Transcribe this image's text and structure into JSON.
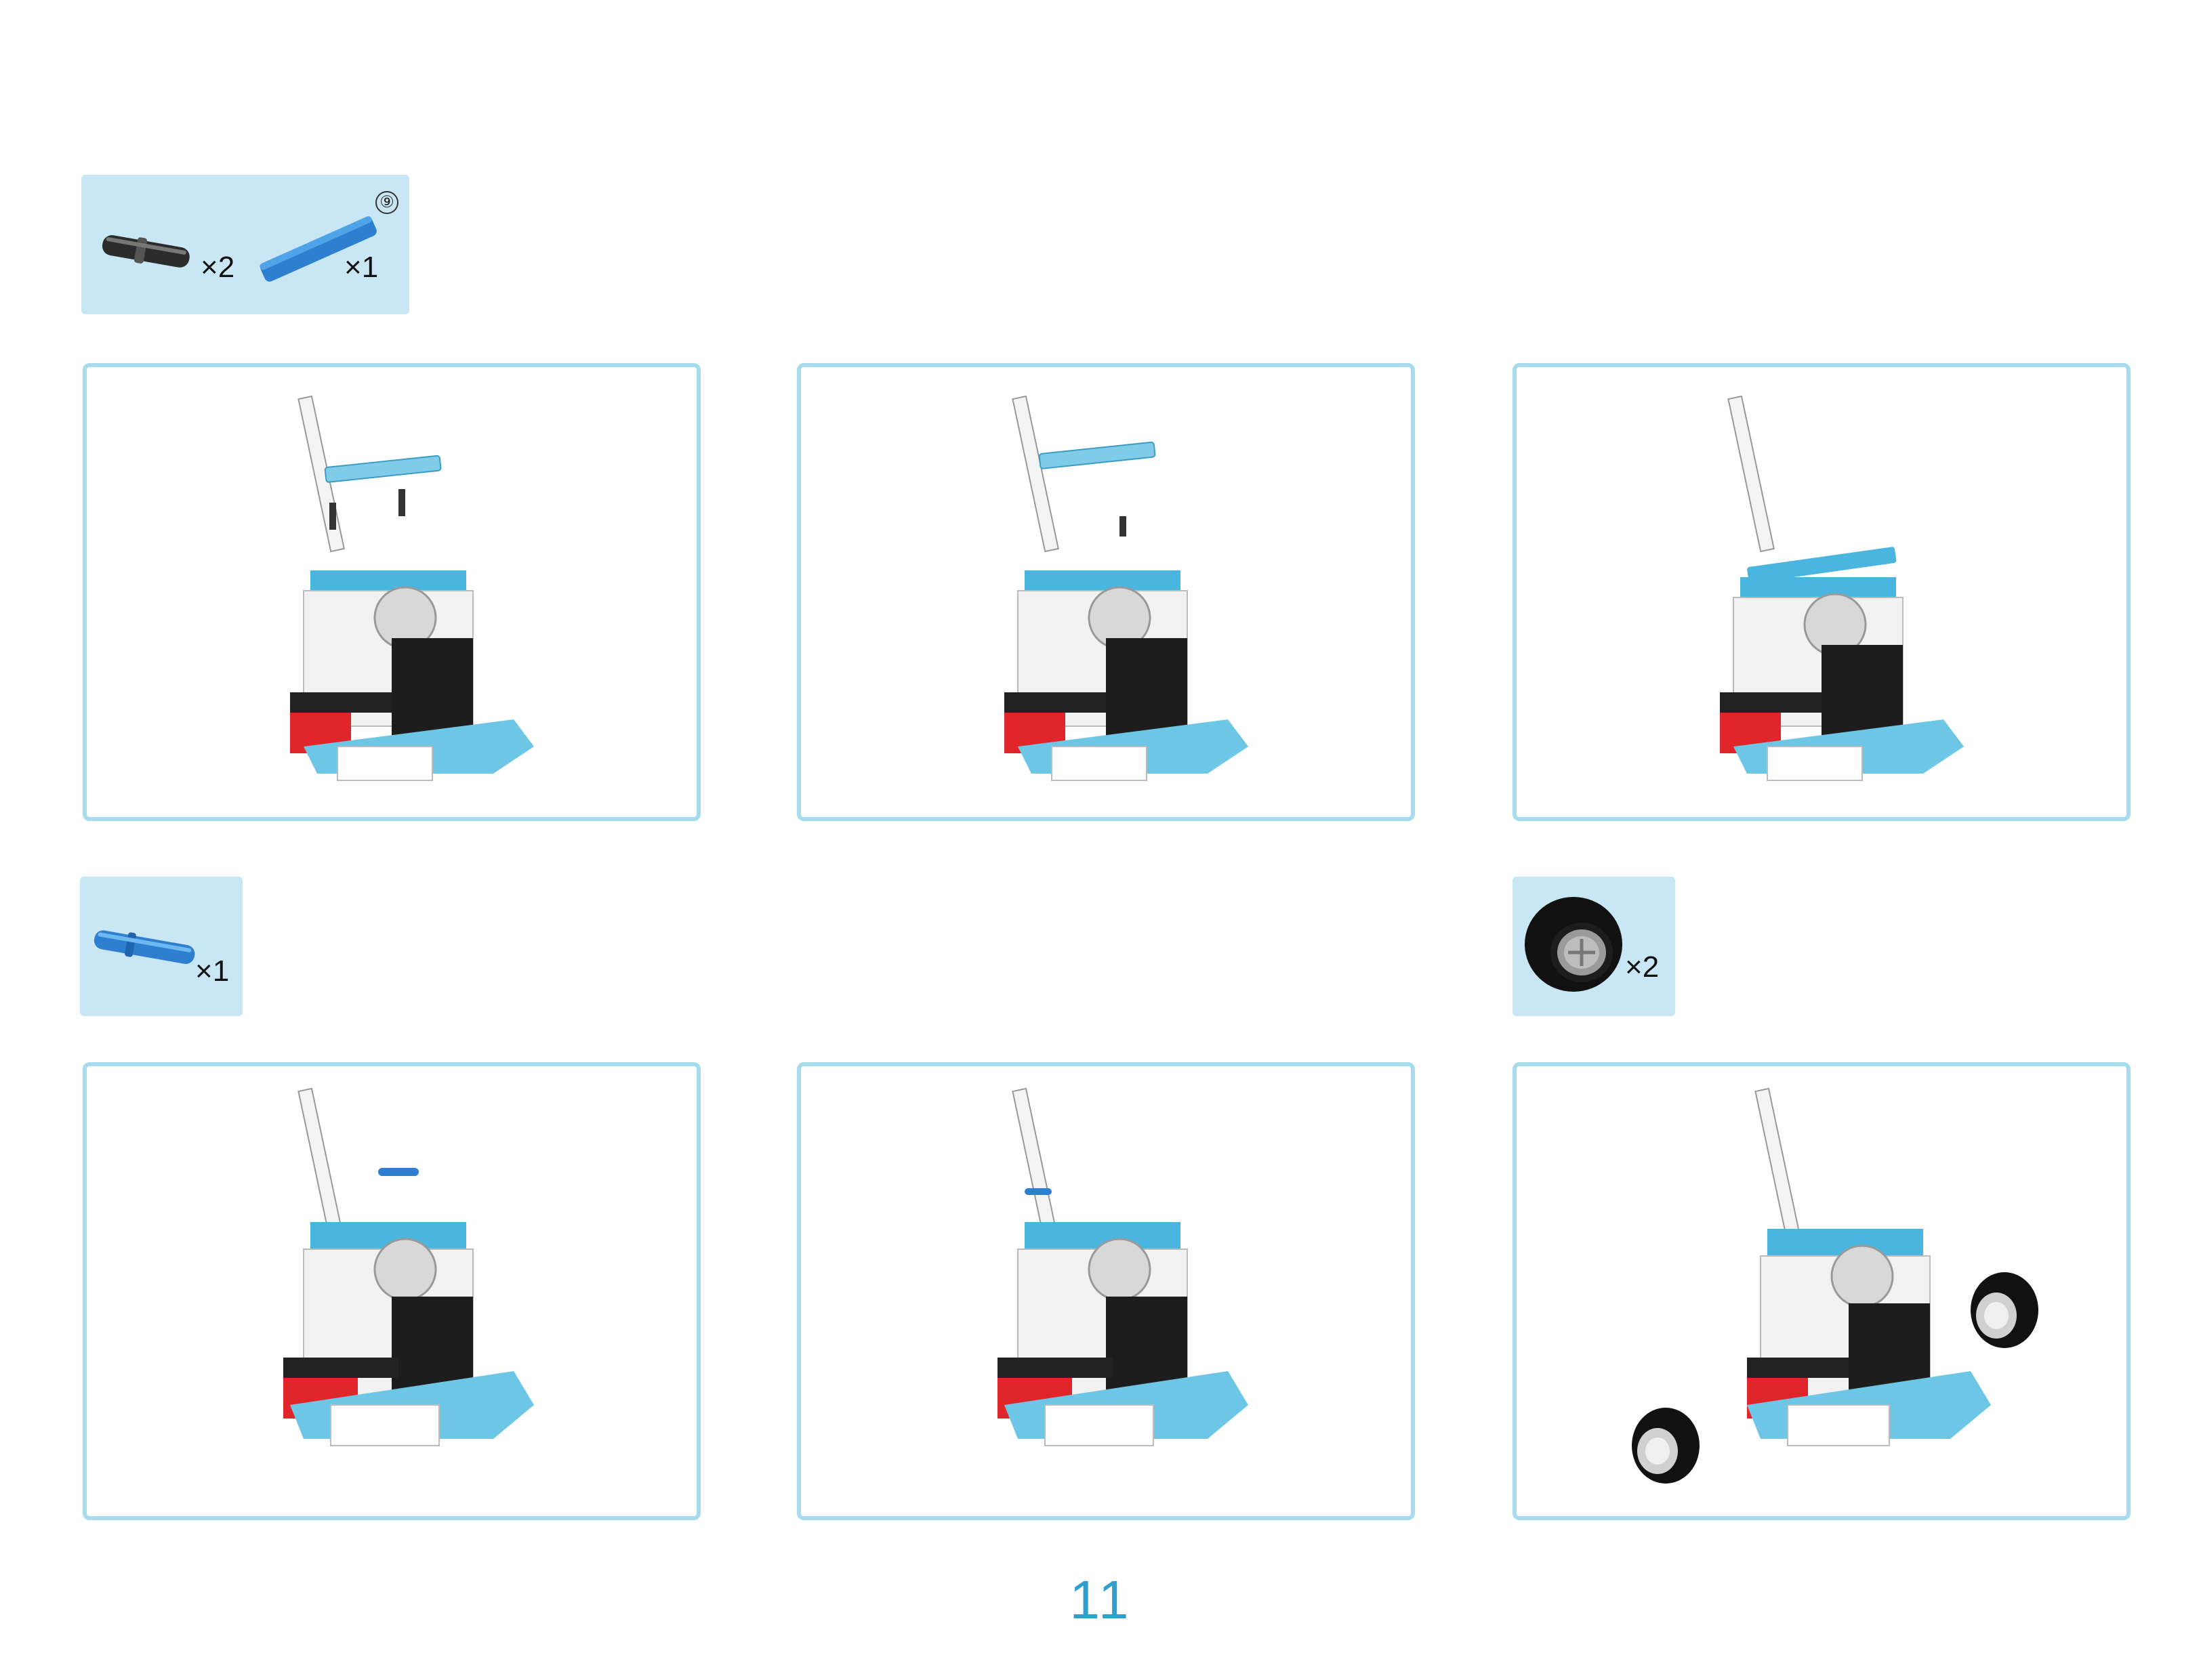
{
  "page": {
    "number": "11"
  },
  "parts_boxes": [
    {
      "items": [
        {
          "part": "black-pin",
          "qty": "×2"
        },
        {
          "part": "blue-beam-9",
          "qty": "×1",
          "badge": "⑨"
        }
      ]
    },
    {
      "items": [
        {
          "part": "blue-axle-pin",
          "qty": "×1"
        }
      ]
    },
    {
      "items": [
        {
          "part": "wheel",
          "qty": "×2"
        }
      ]
    }
  ],
  "steps": [
    {
      "id": 1,
      "description": ""
    },
    {
      "id": 2,
      "description": ""
    },
    {
      "id": 3,
      "description": ""
    },
    {
      "id": 4,
      "description": ""
    },
    {
      "id": 5,
      "description": ""
    },
    {
      "id": 6,
      "description": ""
    }
  ],
  "colors": {
    "frame_border": "#a6dced",
    "parts_bg": "#c9e6f4",
    "accent_blue": "#4ab6df",
    "page_number": "#2f9fce",
    "red": "#e0262b"
  }
}
